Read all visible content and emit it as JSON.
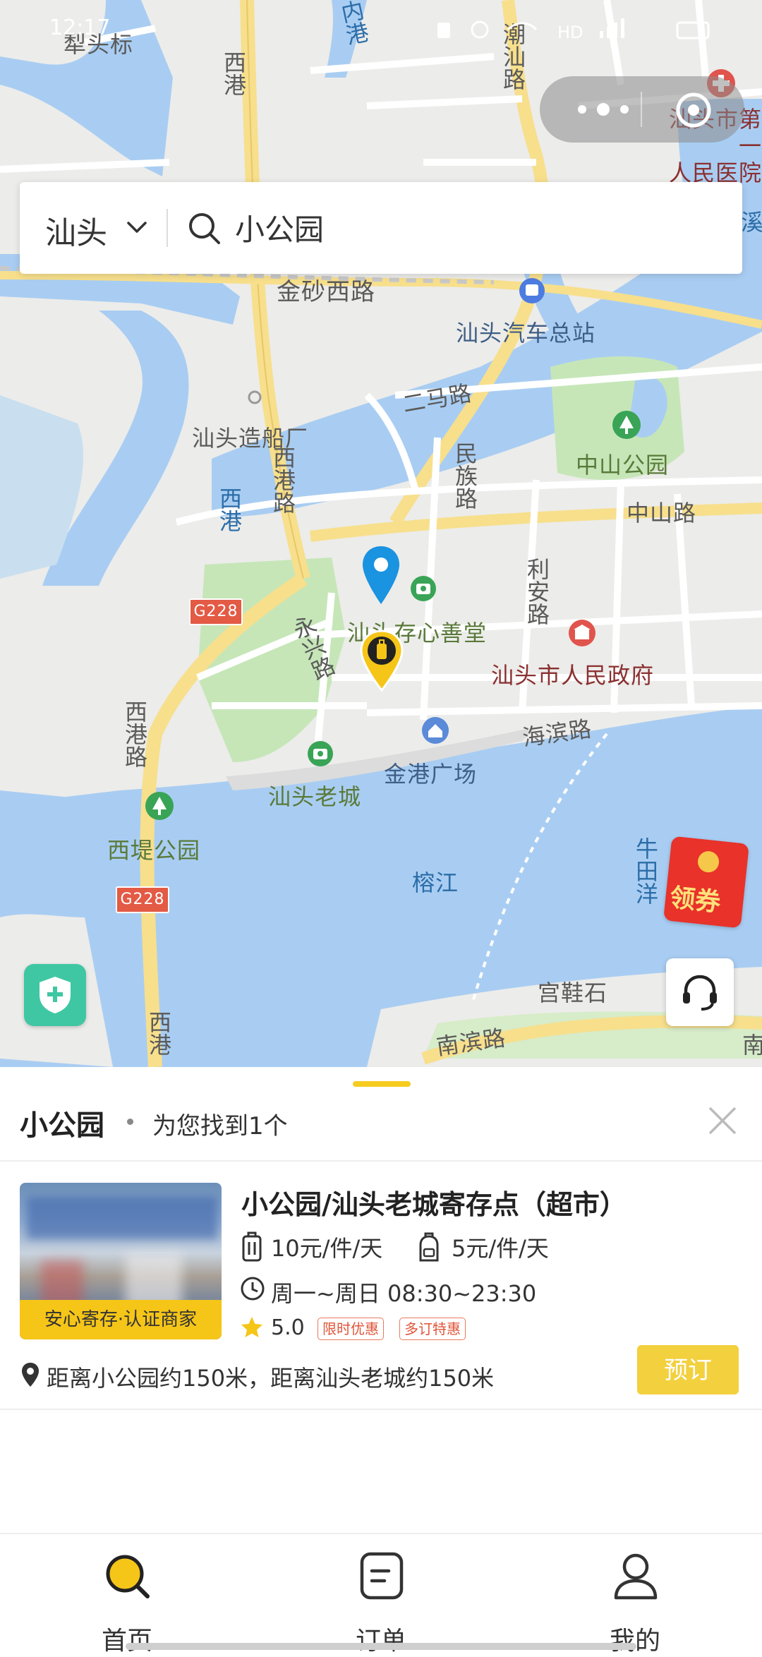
{
  "status_bar": {
    "time": "12:17"
  },
  "map": {
    "labels": {
      "qiantoubiao": "犁头标",
      "xigang_road_top": "西港",
      "neigang": "内港",
      "chaoshan_road": "潮汕路",
      "hospital": "汕头市第一\n人民医院",
      "jinsha_west_road": "金砂西路",
      "bus_station": "汕头汽车总站",
      "erma_road": "二马路",
      "shipyard": "汕头造船厂",
      "minzu_road": "民族路",
      "zhongshan_park": "中山公园",
      "zhongshan_road": "中山路",
      "xigang_road_mid": "西港路",
      "xigang_water": "西港",
      "g228_a": "G228",
      "lian_road": "利安路",
      "yongxing_road": "永兴路",
      "cunxin_hall": "汕头存心善堂",
      "city_gov": "汕头市人民政府",
      "xigang_road_low": "西港路",
      "haibin_road": "海滨路",
      "jingang_square": "金港广场",
      "old_town": "汕头老城",
      "xidi_park": "西堤公园",
      "rongjiang": "榕江",
      "niutianyang": "牛田洋",
      "g228_b": "G228",
      "gongxieshi": "宫鞋石",
      "nanbin_road": "南滨路",
      "xigang_bottom": "西港",
      "xi_right": "溪",
      "nan_right": "南"
    }
  },
  "search": {
    "city": "汕头",
    "query": "小公园"
  },
  "coupon": {
    "label": "领券"
  },
  "panel": {
    "title": "小公园",
    "count_text": "为您找到1个"
  },
  "result": {
    "name": "小公园/汕头老城寄存点（超市）",
    "badge": "安心寄存·认证商家",
    "price_luggage": "10元/件/天",
    "price_bag": "5元/件/天",
    "hours": "周一~周日 08:30~23:30",
    "rating": "5.0",
    "tags": [
      "限时优惠",
      "多订特惠"
    ],
    "distance": "距离小公园约150米，距离汕头老城约150米",
    "book_label": "预订"
  },
  "nav": {
    "home": "首页",
    "orders": "订单",
    "mine": "我的"
  },
  "colors": {
    "accent": "#f5c518",
    "water": "#a9cdf2",
    "green": "#c6e6b8",
    "road_major": "#f7df8c"
  }
}
